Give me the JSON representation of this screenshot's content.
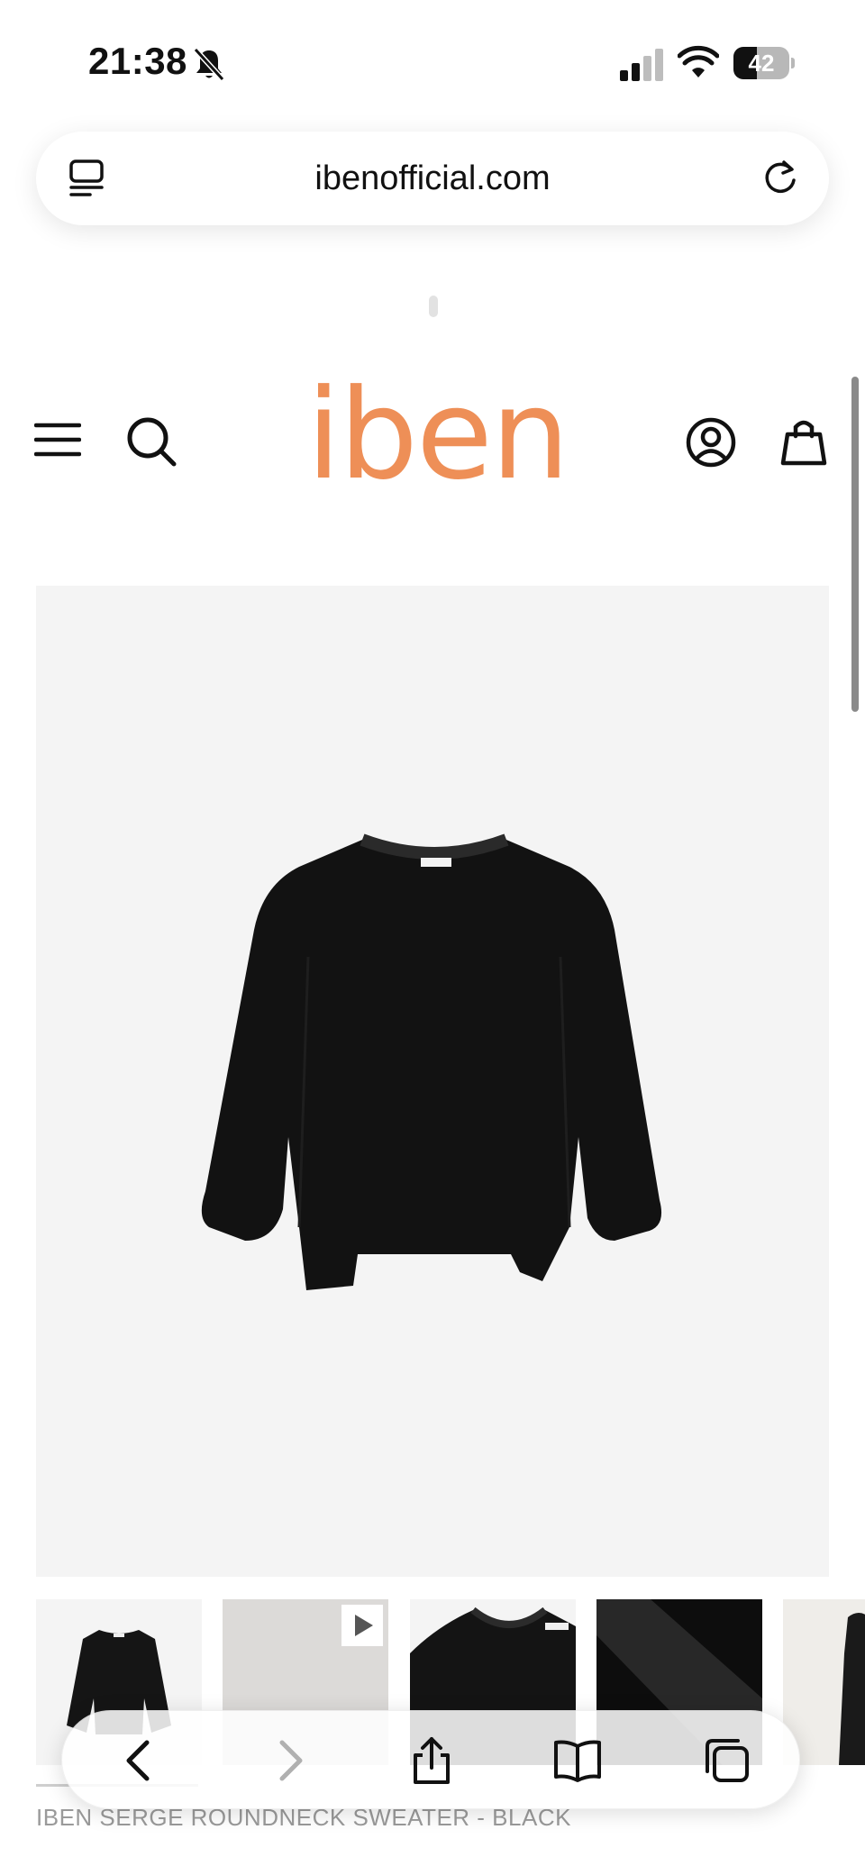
{
  "status_bar": {
    "time": "21:38",
    "battery_level": "42",
    "icons": [
      "bell-slash-icon",
      "cellular-signal-icon",
      "wifi-icon",
      "battery-icon"
    ]
  },
  "browser": {
    "url": "ibenofficial.com"
  },
  "site": {
    "logo_text": "iben",
    "brand_color": "#ee8f57",
    "header_icons": [
      "menu-icon",
      "search-icon",
      "account-icon",
      "bag-icon"
    ]
  },
  "product": {
    "title": "IBEN SERGE ROUNDNECK SWEATER - BLACK",
    "thumbnails": [
      "front-view",
      "video",
      "collar-detail",
      "fabric-detail",
      "model-view"
    ]
  },
  "toolbar": {
    "icons": [
      "back-icon",
      "forward-icon",
      "share-icon",
      "bookmarks-icon",
      "tabs-icon"
    ]
  }
}
